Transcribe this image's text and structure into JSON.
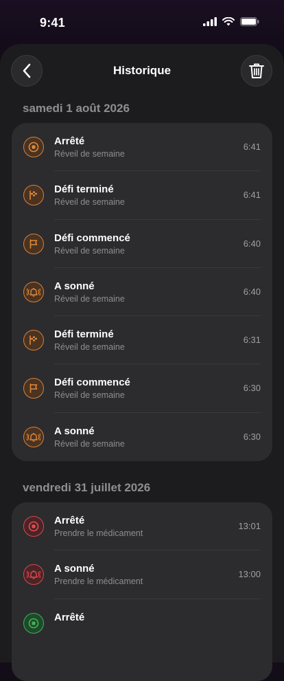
{
  "status": {
    "time": "9:41"
  },
  "header": {
    "title": "Historique"
  },
  "sections": [
    {
      "date": "samedi 1 août 2026",
      "items": [
        {
          "title": "Arrêté",
          "subtitle": "Réveil de semaine",
          "time": "6:41",
          "icon": "stop-icon",
          "color": "orange"
        },
        {
          "title": "Défi terminé",
          "subtitle": "Réveil de semaine",
          "time": "6:41",
          "icon": "checkered-flag-icon",
          "color": "orange"
        },
        {
          "title": "Défi commencé",
          "subtitle": "Réveil de semaine",
          "time": "6:40",
          "icon": "flag-icon",
          "color": "orange"
        },
        {
          "title": "A sonné",
          "subtitle": "Réveil de semaine",
          "time": "6:40",
          "icon": "bell-ringing-icon",
          "color": "orange"
        },
        {
          "title": "Défi terminé",
          "subtitle": "Réveil de semaine",
          "time": "6:31",
          "icon": "checkered-flag-icon",
          "color": "orange"
        },
        {
          "title": "Défi commencé",
          "subtitle": "Réveil de semaine",
          "time": "6:30",
          "icon": "flag-icon",
          "color": "orange"
        },
        {
          "title": "A sonné",
          "subtitle": "Réveil de semaine",
          "time": "6:30",
          "icon": "bell-ringing-icon",
          "color": "orange"
        }
      ]
    },
    {
      "date": "vendredi 31 juillet 2026",
      "items": [
        {
          "title": "Arrêté",
          "subtitle": "Prendre le médicament",
          "time": "13:01",
          "icon": "stop-icon",
          "color": "red"
        },
        {
          "title": "A sonné",
          "subtitle": "Prendre le médicament",
          "time": "13:00",
          "icon": "bell-ringing-icon",
          "color": "red"
        },
        {
          "title": "Arrêté",
          "subtitle": "",
          "time": "",
          "icon": "stop-icon",
          "color": "green"
        }
      ]
    }
  ],
  "colors": {
    "orange": "#e08a3c",
    "red": "#e64a50",
    "green": "#3cb45a",
    "background": "#1c1c1e",
    "card": "#2c2c2e"
  }
}
